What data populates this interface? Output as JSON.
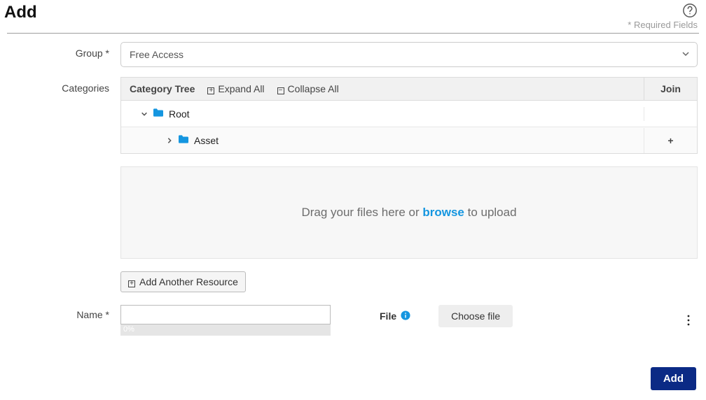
{
  "title": "Add",
  "required_fields_hint": "* Required Fields",
  "labels": {
    "group": "Group *",
    "categories": "Categories",
    "name": "Name *",
    "file": "File"
  },
  "group": {
    "selected": "Free Access"
  },
  "categories_panel": {
    "tree_label": "Category Tree",
    "expand_all": "Expand All",
    "collapse_all": "Collapse All",
    "join_label": "Join",
    "rows": [
      {
        "name": "Root",
        "expandable": true,
        "expanded": true,
        "depth": 0,
        "join": ""
      },
      {
        "name": "Asset",
        "expandable": true,
        "expanded": false,
        "depth": 1,
        "join": "+"
      }
    ]
  },
  "dropzone": {
    "prefix": "Drag your files here or ",
    "browse": "browse",
    "suffix": " to upload"
  },
  "add_resource_label": "Add Another Resource",
  "name_value": "",
  "progress_text": "0%",
  "choose_file_label": "Choose file",
  "submit_label": "Add"
}
